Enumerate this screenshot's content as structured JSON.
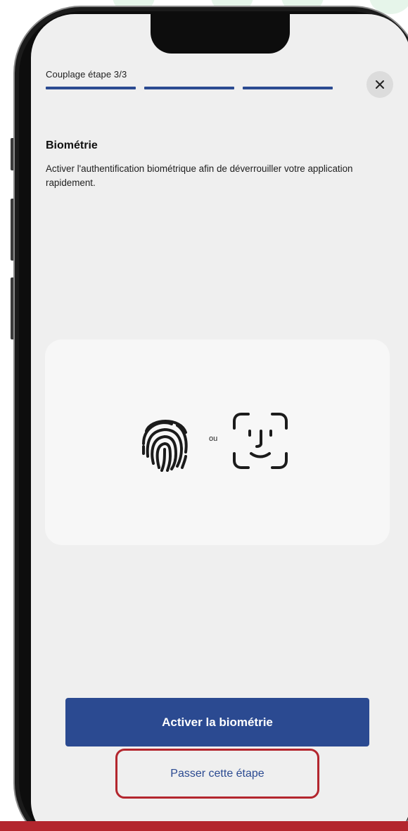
{
  "header": {
    "step_label": "Couplage étape 3/3",
    "progress_total_steps": 3,
    "progress_completed_steps": 3,
    "close_icon": "close-icon"
  },
  "content": {
    "title": "Biométrie",
    "description": "Activer l'authentification biométrique afin de déverrouiller votre application rapidement.",
    "illustration": {
      "left_icon": "fingerprint-icon",
      "separator": "ou",
      "right_icon": "face-id-icon"
    }
  },
  "actions": {
    "primary_label": "Activer la biométrie",
    "secondary_label": "Passer cette étape"
  },
  "colors": {
    "brand_blue": "#2b4a91",
    "highlight_red": "#b3262e",
    "screen_bg": "#efefef",
    "card_bg": "#f7f7f7"
  }
}
